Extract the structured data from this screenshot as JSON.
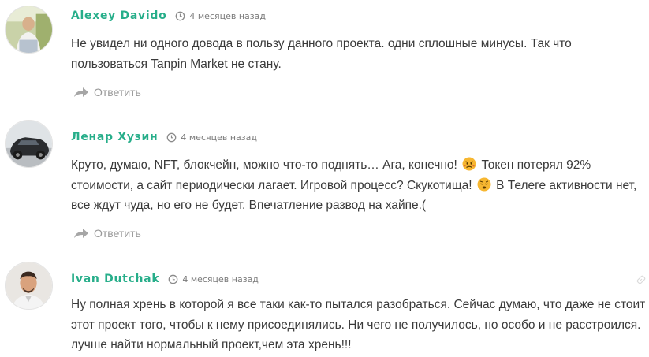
{
  "comments": [
    {
      "author": "Alexey Davido",
      "time": "4 месяцев назад",
      "text": "Не увидел ни одного довода в пользу данного проекта. одни сплошные минусы. Так что пользоваться Tanpin Market не стану.",
      "reply_label": "Ответить",
      "avatar_icon": "user-photo-avatar"
    },
    {
      "author": "Ленар Хузин",
      "time": "4 месяцев назад",
      "text_part1": "Круто, думаю, NFT, блокчейн, можно что-то поднять… Ага, конечно!",
      "text_part2": "Токен потерял 92% стоимости, а сайт периодически лагает. Игровой процесс? Скукотища!",
      "text_part3": "В Телеге активности нет, все ждут чуда, но его не будет. Впечатление развод на хайпе.(",
      "emoji1": "angry-face-emoji",
      "emoji2": "sleepy-face-emoji",
      "reply_label": "Ответить",
      "avatar_icon": "car-photo-avatar"
    },
    {
      "author": "Ivan Dutchak",
      "time": "4 месяцев назад",
      "text": "Ну полная хрень в которой я все таки как-то пытался разобраться. Сейчас думаю, что даже не стоит этот проект того, чтобы к нему присоединялись. Ни чего не получилось, но особо и не расстроился. лучше найти нормальный проект,чем эта хрень!!!",
      "avatar_icon": "man-photo-avatar"
    }
  ],
  "colors": {
    "author": "#27ae8a",
    "meta": "#7a7a7a",
    "reply": "#999999",
    "text": "#3a3a3a"
  }
}
